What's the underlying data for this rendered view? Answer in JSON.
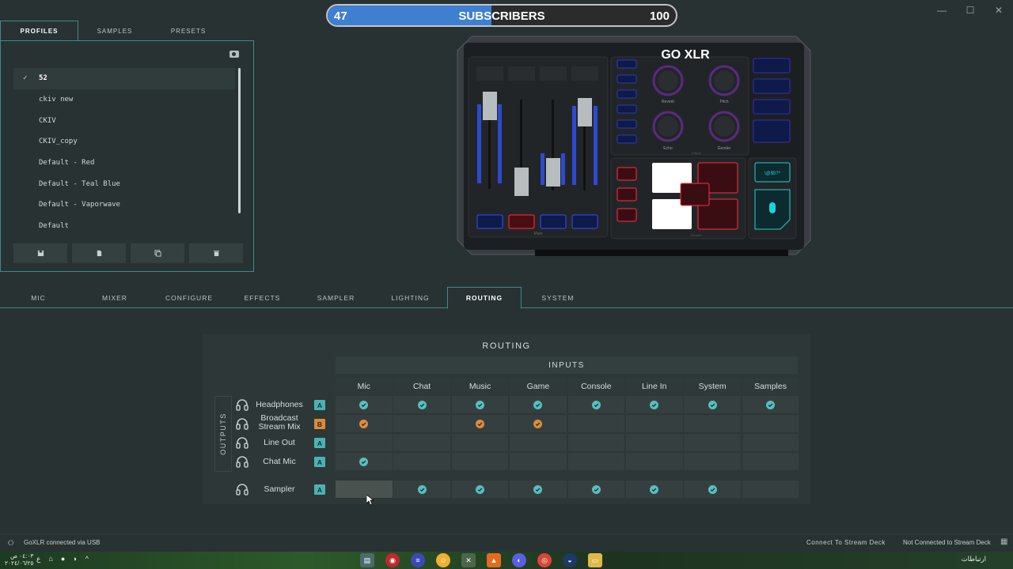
{
  "subscribers": {
    "current": "47",
    "label": "SUBSCRIBERS",
    "goal": "100",
    "progress_fraction": 0.47
  },
  "profiles_tabs": [
    "PROFILES",
    "SAMPLES",
    "PRESETS"
  ],
  "profiles": [
    {
      "name": "52",
      "selected": true
    },
    {
      "name": "ckiv new",
      "selected": false
    },
    {
      "name": "CKIV",
      "selected": false
    },
    {
      "name": "CKIV_copy",
      "selected": false
    },
    {
      "name": "Default - Red",
      "selected": false
    },
    {
      "name": "Default - Teal Blue",
      "selected": false
    },
    {
      "name": "Default - Vaporwave",
      "selected": false
    },
    {
      "name": "Default",
      "selected": false
    }
  ],
  "profile_buttons": [
    "save-icon",
    "new-file-icon",
    "copy-icon",
    "trash-icon"
  ],
  "device": {
    "logo": "GO XLR",
    "knobs": [
      "Reverb",
      "Pitch",
      "Echo",
      "Gender"
    ],
    "effects_label": "Effects",
    "mute_label": "Mute",
    "sampler_label": "Sampler",
    "cough_label": "\\@$5?*"
  },
  "main_tabs": [
    "MIC",
    "MIXER",
    "CONFIGURE",
    "EFFECTS",
    "SAMPLER",
    "LIGHTING",
    "ROUTING",
    "SYSTEM"
  ],
  "active_tab": "ROUTING",
  "routing": {
    "title": "ROUTING",
    "inputs_label": "INPUTS",
    "outputs_label": "OUTPUTS",
    "inputs": [
      "Mic",
      "Chat",
      "Music",
      "Game",
      "Console",
      "Line In",
      "System",
      "Samples"
    ],
    "outputs": [
      {
        "name": "Headphones",
        "badge": "A",
        "routes": [
          "t",
          "t",
          "t",
          "t",
          "t",
          "t",
          "t",
          "t"
        ]
      },
      {
        "name": "Broadcast\nStream Mix",
        "badge": "B",
        "routes": [
          "o",
          "",
          "o",
          "o",
          "",
          "",
          "",
          ""
        ]
      },
      {
        "name": "Line Out",
        "badge": "A",
        "routes": [
          "",
          "",
          "",
          "",
          "",
          "",
          "",
          ""
        ]
      },
      {
        "name": "Chat Mic",
        "badge": "A",
        "routes": [
          "t",
          "",
          "",
          "",
          "",
          "",
          "",
          ""
        ]
      }
    ],
    "sampler": {
      "name": "Sampler",
      "badge": "A",
      "routes": [
        "",
        "t",
        "t",
        "t",
        "t",
        "t",
        "t",
        ""
      ]
    }
  },
  "status": {
    "connection": "GoXLR connected via USB",
    "stream_deck_button": "Connect To Stream Deck",
    "stream_deck_status": "Not Connected to Stream Deck"
  },
  "taskbar": {
    "time": "٠٤:٠٣ ص",
    "date": "٢٠٢٤/٠٦/٢٥",
    "tray_label": "ارتباطات",
    "lang": "ع"
  },
  "colors": {
    "accent_teal": "#49b3b3",
    "accent_orange": "#e08a35",
    "bg": "#283232"
  }
}
